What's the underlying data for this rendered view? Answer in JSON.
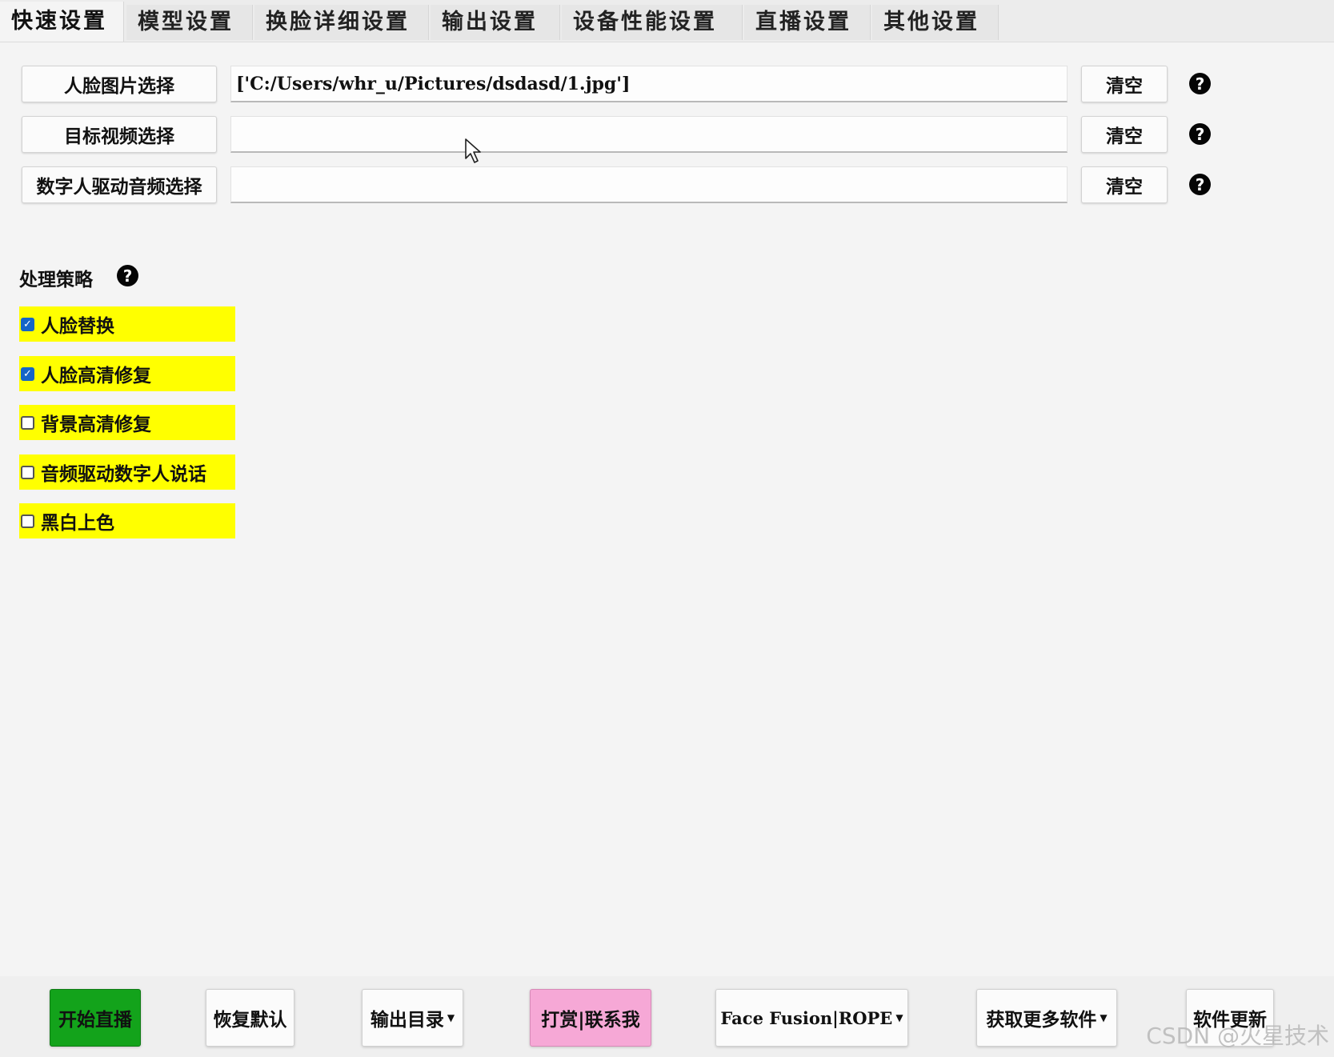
{
  "tabs": [
    "快速设置",
    "模型设置",
    "换脸详细设置",
    "输出设置",
    "设备性能设置",
    "直播设置",
    "其他设置"
  ],
  "file_rows": [
    {
      "button": "人脸图片选择",
      "value": "['C:/Users/whr_u/Pictures/dsdasd/1.jpg']",
      "clear": "清空",
      "help": "?"
    },
    {
      "button": "目标视频选择",
      "value": "",
      "clear": "清空",
      "help": "?"
    },
    {
      "button": "数字人驱动音频选择",
      "value": "",
      "clear": "清空",
      "help": "?"
    }
  ],
  "strategy": {
    "label": "处理策略",
    "help": "?",
    "options": [
      {
        "label": "人脸替换",
        "checked": true
      },
      {
        "label": "人脸高清修复",
        "checked": true
      },
      {
        "label": "背景高清修复",
        "checked": false
      },
      {
        "label": "音频驱动数字人说话",
        "checked": false
      },
      {
        "label": "黑白上色",
        "checked": false
      }
    ]
  },
  "bottom_buttons": {
    "start_live": "开始直播",
    "restore_default": "恢复默认",
    "output_dir": "输出目录",
    "reward_contact": "打赏|联系我",
    "engine": "Face Fusion|ROPE",
    "more_software": "获取更多软件",
    "update": "软件更新"
  },
  "watermark": "CSDN @火星技术",
  "colors": {
    "highlight": "#ffff00",
    "start_green": "#13a31b",
    "reward_pink": "#f6a8d6",
    "checkbox_blue": "#1565c8"
  }
}
